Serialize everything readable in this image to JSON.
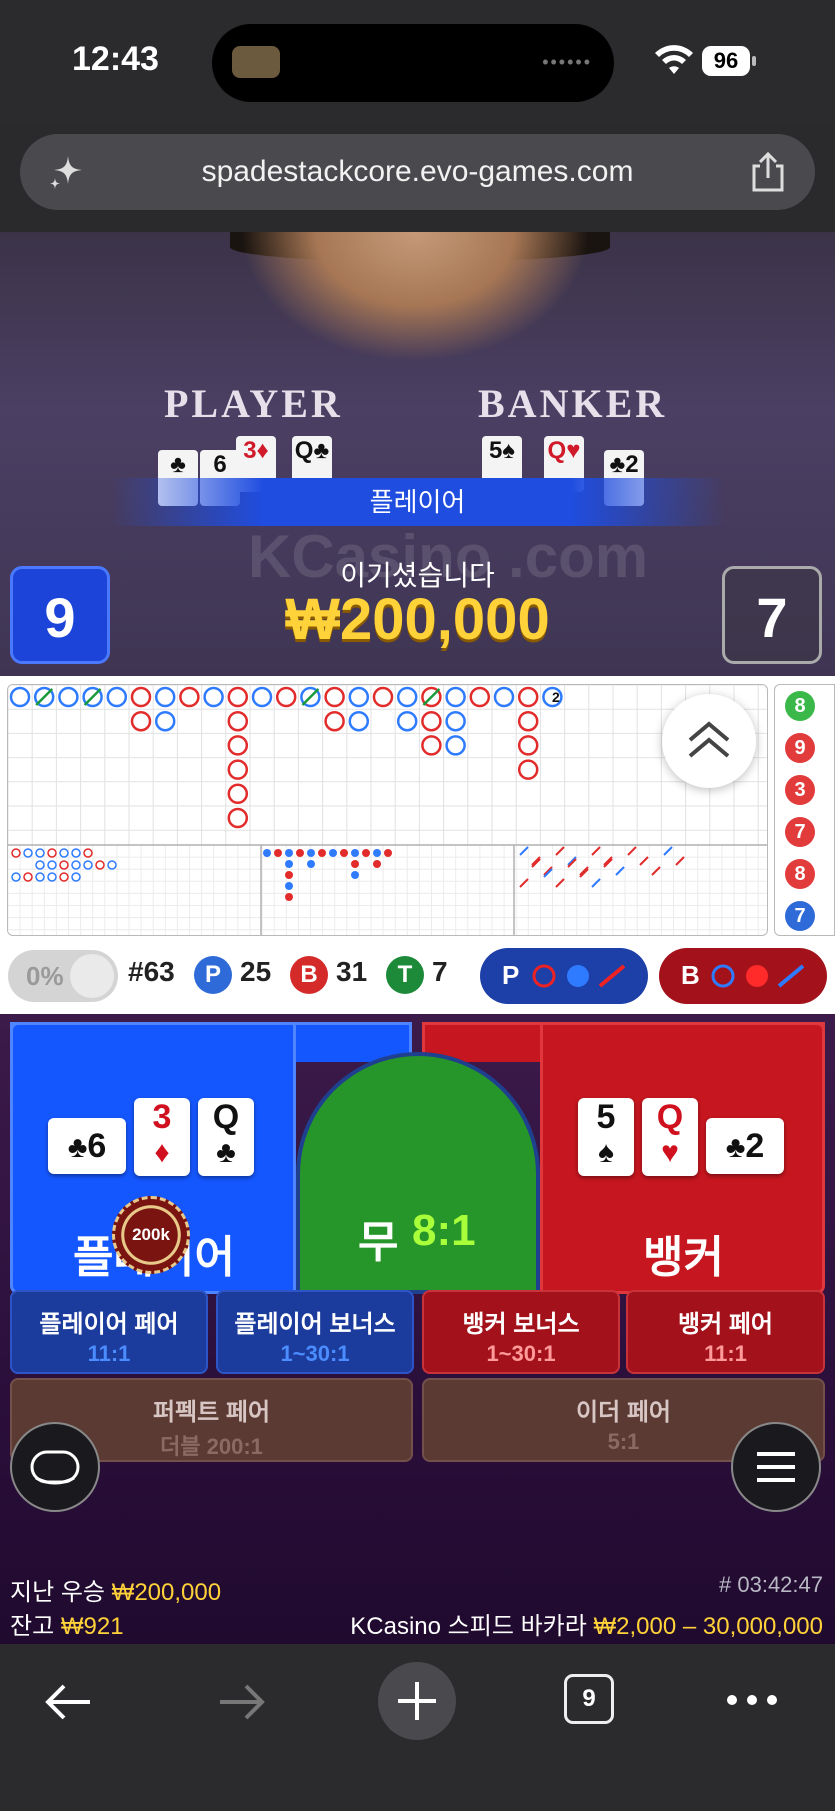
{
  "status_bar": {
    "time": "12:43",
    "battery": "96"
  },
  "browser": {
    "url": "spadestackcore.evo-games.com",
    "tab_count": "9"
  },
  "video": {
    "table_labels": {
      "player": "PLAYER",
      "banker": "BANKER"
    },
    "player_cards": [
      {
        "rank": "6",
        "suit": "♣"
      },
      {
        "rank": "3",
        "suit": "♦"
      },
      {
        "rank": "Q",
        "suit": "♣"
      }
    ],
    "banker_cards": [
      {
        "rank": "5",
        "suit": "♠"
      },
      {
        "rank": "Q",
        "suit": "♥"
      },
      {
        "rank": "2",
        "suit": "♣"
      }
    ],
    "winner_banner": "플레이어",
    "watermark": "KCasino .com",
    "win_message": "이기셨습니다",
    "win_amount": "₩200,000",
    "player_score": "9",
    "banker_score": "7"
  },
  "roadmap": {
    "big_road_mark": "2",
    "side_road": [
      {
        "value": "8",
        "color": "#3ab84a"
      },
      {
        "value": "9",
        "color": "#e23b3b"
      },
      {
        "value": "3",
        "color": "#e23b3b"
      },
      {
        "value": "7",
        "color": "#e23b3b"
      },
      {
        "value": "8",
        "color": "#e23b3b"
      },
      {
        "value": "7",
        "color": "#2f6bd8"
      }
    ]
  },
  "stats": {
    "percent": "0%",
    "round": "#63",
    "player_letter": "P",
    "player_count": "25",
    "banker_letter": "B",
    "banker_count": "31",
    "tie_letter": "T",
    "tie_count": "7",
    "player_predict_label": "P",
    "banker_predict_label": "B"
  },
  "bets": {
    "player_label": "플레이어",
    "tie_label": "무",
    "tie_odds": "8:1",
    "banker_label": "뱅커",
    "chip_value": "200k",
    "player_cards": [
      {
        "rank": "6",
        "suit": "♣"
      },
      {
        "rank": "3",
        "suit": "♦"
      },
      {
        "rank": "Q",
        "suit": "♣"
      }
    ],
    "banker_cards": [
      {
        "rank": "5",
        "suit": "♠"
      },
      {
        "rank": "Q",
        "suit": "♥"
      },
      {
        "rank": "2",
        "suit": "♣"
      }
    ],
    "side_bets": [
      {
        "title": "플레이어 페어",
        "odds": "11:1"
      },
      {
        "title": "플레이어 보너스",
        "odds": "1~30:1"
      },
      {
        "title": "뱅커 보너스",
        "odds": "1~30:1"
      },
      {
        "title": "뱅커 페어",
        "odds": "11:1"
      }
    ],
    "perfect_pair": {
      "title": "퍼펙트 페어",
      "odds": "더블 200:1"
    },
    "either_pair": {
      "title": "이더 페어",
      "odds": "5:1"
    }
  },
  "info": {
    "last_win_label": "지난 우승",
    "last_win_amount": "₩200,000",
    "balance_label": "잔고",
    "balance_amount": "₩921",
    "game_id": "# 03:42:47",
    "table_name": "KCasino 스피드 바카라",
    "bet_limits": "₩2,000 – 30,000,000"
  },
  "colors": {
    "player_blue": "#1557ff",
    "banker_red": "#c6161f",
    "tie_green": "#27962a",
    "highlight_yellow": "#ffd23a"
  }
}
